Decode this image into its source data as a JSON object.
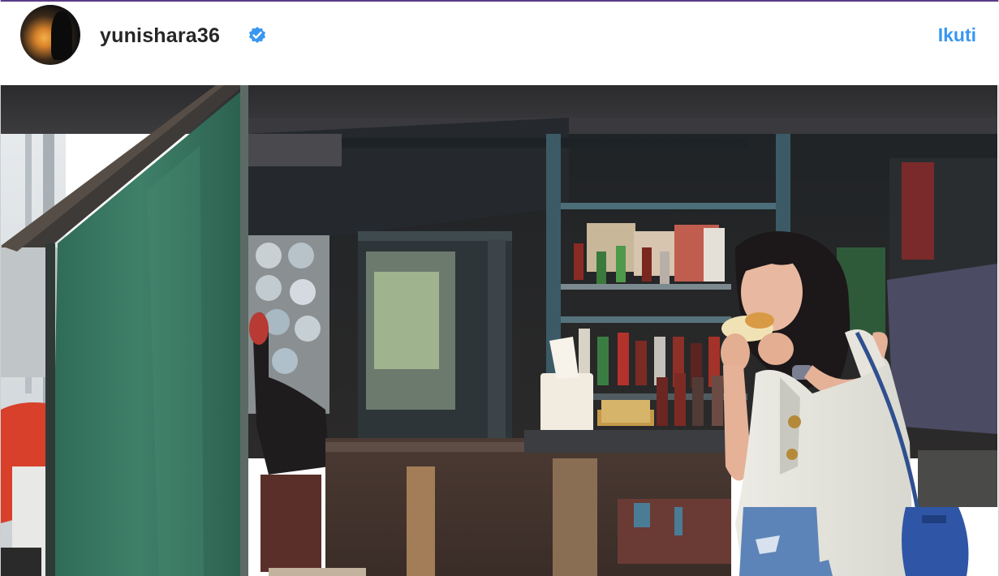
{
  "post": {
    "username": "yunishara36",
    "verified": true,
    "follow_label": "Ikuti"
  },
  "icons": {
    "verified": "verified-badge-icon",
    "avatar": "profile-avatar"
  },
  "colors": {
    "follow": "#3897f0",
    "verified_badge": "#3897f0",
    "username": "#262626",
    "top_accent": "#5b3c88"
  }
}
